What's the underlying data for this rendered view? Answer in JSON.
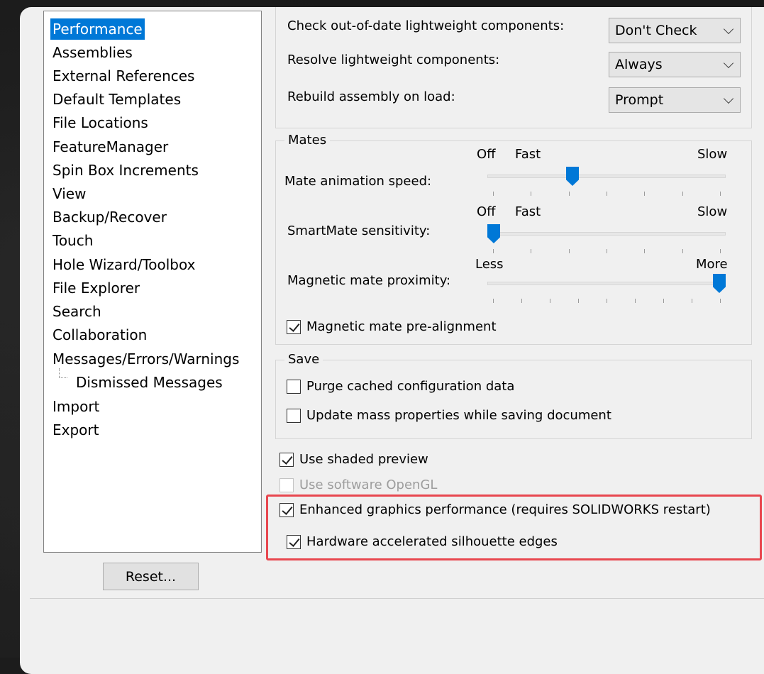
{
  "sidebar": {
    "items": [
      {
        "label": "Performance",
        "selected": true
      },
      {
        "label": "Assemblies"
      },
      {
        "label": "External References"
      },
      {
        "label": "Default Templates"
      },
      {
        "label": "File Locations"
      },
      {
        "label": "FeatureManager"
      },
      {
        "label": "Spin Box Increments"
      },
      {
        "label": "View"
      },
      {
        "label": "Backup/Recover"
      },
      {
        "label": "Touch"
      },
      {
        "label": "Hole Wizard/Toolbox"
      },
      {
        "label": "File Explorer"
      },
      {
        "label": "Search"
      },
      {
        "label": "Collaboration"
      },
      {
        "label": "Messages/Errors/Warnings"
      },
      {
        "label": "Dismissed Messages",
        "child": true
      },
      {
        "label": "Import"
      },
      {
        "label": "Export"
      }
    ],
    "reset_label": "Reset..."
  },
  "assemblies": {
    "check_lightweight": {
      "label": "Check out-of-date lightweight components:",
      "value": "Don't Check"
    },
    "resolve_lightweight": {
      "label": "Resolve lightweight components:",
      "value": "Always"
    },
    "rebuild_on_load": {
      "label": "Rebuild assembly on load:",
      "value": "Prompt"
    },
    "dropdown_icon": "chevron-down-icon"
  },
  "mates": {
    "title": "Mates",
    "animation_speed": {
      "label": "Mate animation speed:",
      "min_label": "Off",
      "mid_label": "Fast",
      "max_label": "Slow",
      "level": 0.35
    },
    "smartmate_sensitivity": {
      "label": "SmartMate sensitivity:",
      "min_label": "Off",
      "mid_label": "Fast",
      "max_label": "Slow",
      "level": 0.0
    },
    "magnetic_proximity": {
      "label": "Magnetic mate proximity:",
      "min_label": "Less",
      "max_label": "More",
      "level": 1.0
    },
    "prealignment": {
      "label": "Magnetic mate pre-alignment",
      "checked": true
    }
  },
  "save": {
    "title": "Save",
    "purge_cached": {
      "label": "Purge cached configuration data",
      "checked": false
    },
    "update_mass": {
      "label": "Update mass properties while saving document",
      "checked": false
    }
  },
  "display": {
    "shaded_preview": {
      "label": "Use shaded preview",
      "checked": true
    },
    "software_opengl": {
      "label": "Use software OpenGL",
      "checked": false,
      "disabled": true
    },
    "enhanced_graphics": {
      "label": "Enhanced graphics performance (requires SOLIDWORKS restart)",
      "checked": true
    },
    "silhouette_edges": {
      "label": "Hardware accelerated silhouette edges",
      "checked": true
    }
  },
  "colors": {
    "selection": "#0078d7",
    "highlight": "#e8474f",
    "slider_thumb": "#0078d7"
  }
}
